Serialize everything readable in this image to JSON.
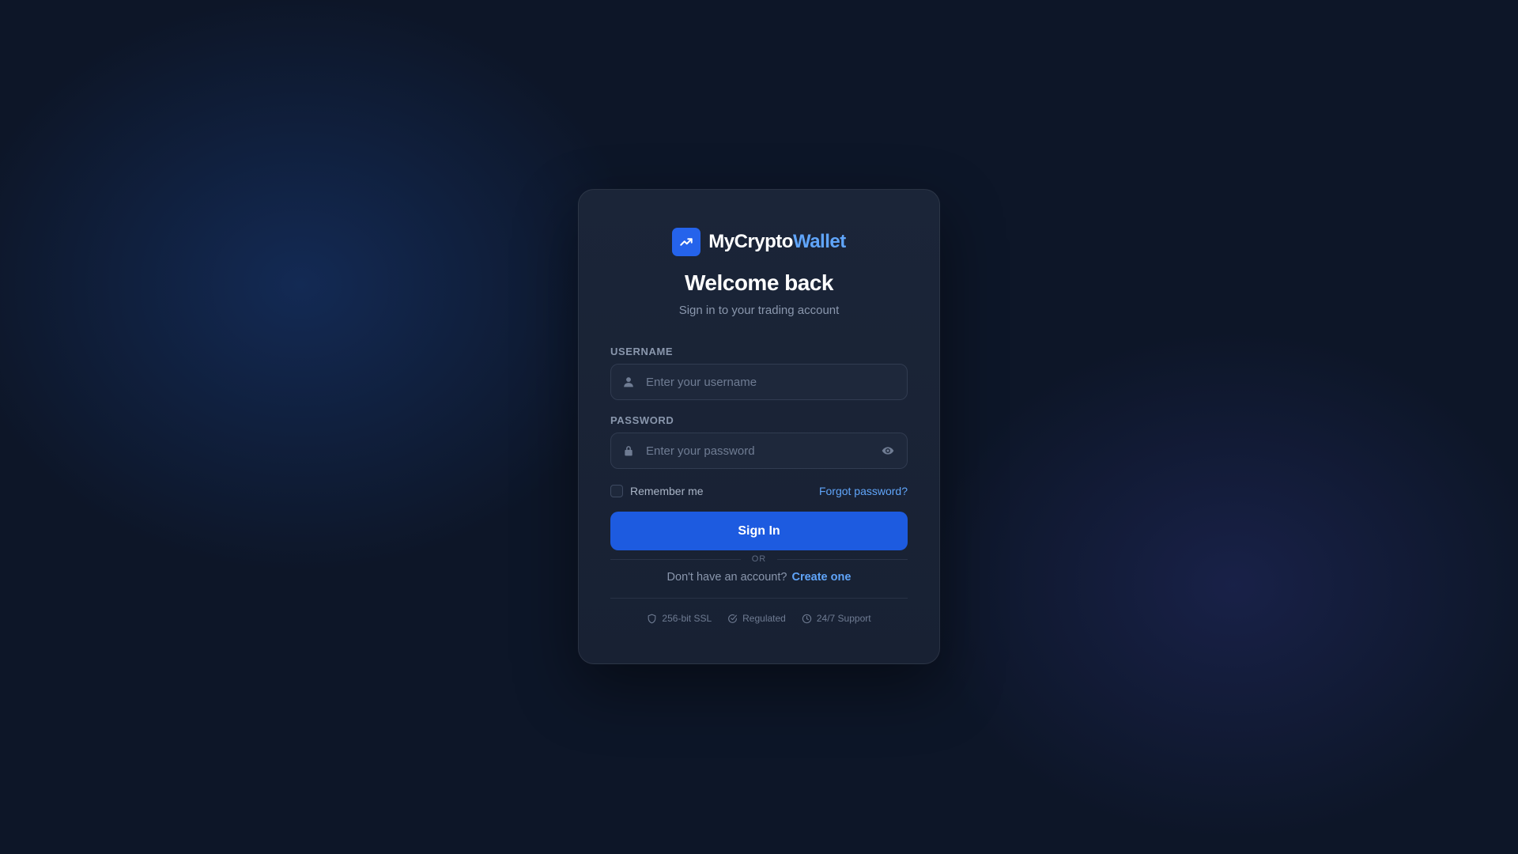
{
  "brand": {
    "name_part1": "MyCrypto",
    "name_part2": "Wallet",
    "logo_icon": "trending-up-icon",
    "accent_color": "#60a5fa"
  },
  "header": {
    "title": "Welcome back",
    "subtitle": "Sign in to your trading account"
  },
  "form": {
    "username": {
      "label": "USERNAME",
      "placeholder": "Enter your username",
      "value": "",
      "icon": "user-icon"
    },
    "password": {
      "label": "PASSWORD",
      "placeholder": "Enter your password",
      "value": "",
      "icon": "lock-icon",
      "toggle_icon": "eye-icon"
    },
    "remember_label": "Remember me",
    "remember_checked": false,
    "forgot_label": "Forgot password?",
    "submit_label": "Sign In",
    "primary_color": "#1d5be0"
  },
  "divider_text": "OR",
  "signup": {
    "prompt": "Don't have an account?",
    "link_label": "Create one"
  },
  "trust_badges": [
    {
      "label": "256-bit SSL",
      "icon": "shield-icon"
    },
    {
      "label": "Regulated",
      "icon": "check-circle-icon"
    },
    {
      "label": "24/7 Support",
      "icon": "clock-icon"
    }
  ]
}
